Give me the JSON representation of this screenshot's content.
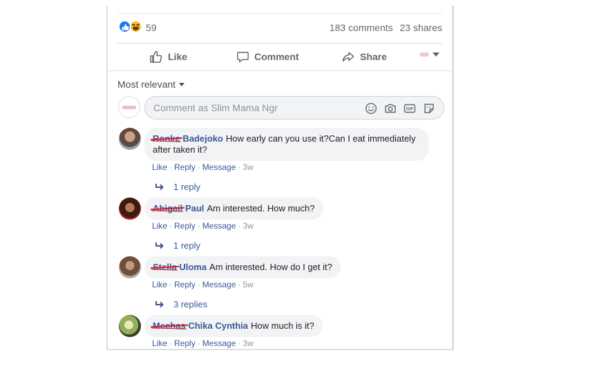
{
  "reactions": {
    "icons": [
      "like-icon",
      "haha-icon"
    ],
    "count": "59",
    "comments": "183 comments",
    "shares": "23 shares"
  },
  "actions": {
    "like": "Like",
    "comment": "Comment",
    "share": "Share"
  },
  "sort": {
    "label": "Most relevant"
  },
  "composer": {
    "placeholder": "Comment as Slim Mama Ngr",
    "icons": [
      "emoji-icon",
      "camera-icon",
      "gif-icon",
      "sticker-icon"
    ]
  },
  "comments": [
    {
      "first": "Ronke",
      "last": "Badejoko",
      "text": "How early can you use it?Can I eat immediately after taken it?",
      "time": "3w",
      "replies": "1 reply"
    },
    {
      "first": "Abigail",
      "last": "Paul",
      "text": "Am interested. How much?",
      "time": "3w",
      "replies": "1 reply"
    },
    {
      "first": "Stella",
      "last": "Uloma",
      "text": "Am interested. How do I get it?",
      "time": "5w",
      "replies": "3 replies"
    },
    {
      "first": "Mechas",
      "last": "Chika Cynthia",
      "text": "How much is it?",
      "time": "3w",
      "replies": ""
    }
  ],
  "comment_actions": {
    "like": "Like",
    "reply": "Reply",
    "message": "Message"
  },
  "colors": {
    "accent": "#385898",
    "like_blue": "#1877f2",
    "muted": "#90949c",
    "bubble": "#f2f3f5",
    "redaction": "#d3202a"
  }
}
